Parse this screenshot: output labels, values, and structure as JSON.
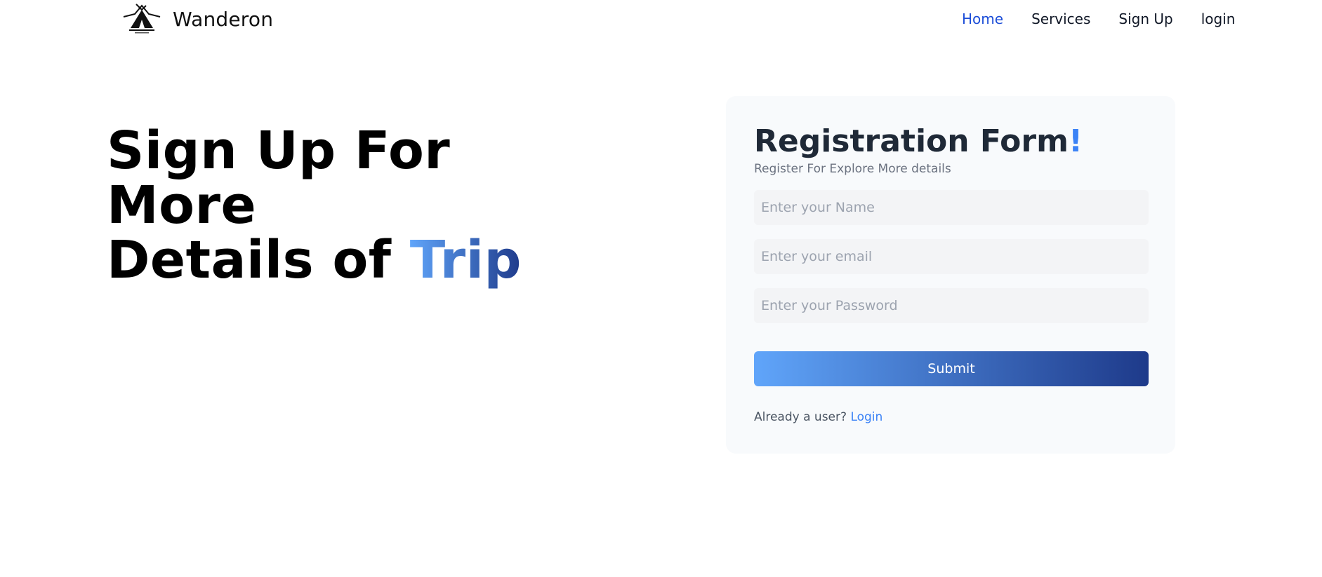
{
  "brand": {
    "name": "Wanderon",
    "logo_icon": "tent-logo-icon"
  },
  "nav": {
    "items": [
      {
        "label": "Home",
        "active": true
      },
      {
        "label": "Services",
        "active": false
      },
      {
        "label": "Sign Up",
        "active": false
      },
      {
        "label": "login",
        "active": false
      }
    ]
  },
  "hero": {
    "line1": "Sign Up For More",
    "line2_prefix": "Details of ",
    "line2_accent": "Trip"
  },
  "form": {
    "title": "Registration Form",
    "title_accent": "!",
    "subtitle": "Register For Explore More details",
    "name_placeholder": "Enter your Name",
    "email_placeholder": "Enter your email",
    "password_placeholder": "Enter your Password",
    "name_value": "",
    "email_value": "",
    "password_value": "",
    "submit_label": "Submit",
    "already_text": "Already a user?",
    "login_link": "Login"
  },
  "colors": {
    "accent_start": "#60a5fa",
    "accent_end": "#1e3a8a",
    "nav_active": "#1d4ed8",
    "card_bg": "#f8fafc",
    "input_bg": "#f3f4f6"
  }
}
